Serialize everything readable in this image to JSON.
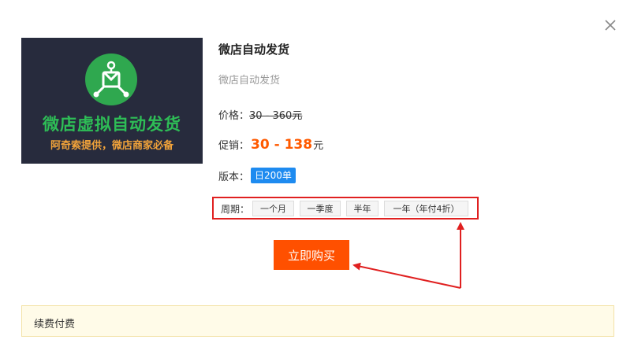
{
  "dialog": {
    "close_icon": "close-icon"
  },
  "banner": {
    "logo_icon": "shop-delivery-logo",
    "title": "微店虚拟自动发货",
    "subtitle": "阿奇索提供，微店商家必备",
    "colors": {
      "background": "#272b3d",
      "logo": "#2fa84f",
      "title": "#2ebd56",
      "subtitle": "#f2a33a"
    }
  },
  "product": {
    "title": "微店自动发货",
    "description": "微店自动发货",
    "price_label": "价格：",
    "price_value": "30 - 360元",
    "sale_label": "促销：",
    "sale_value": "30 - 138",
    "sale_unit": "元",
    "version_label": "版本：",
    "version_value": "日200单"
  },
  "period": {
    "label": "周期：",
    "options": [
      "一个月",
      "一季度",
      "半年",
      "一年（年付4折）"
    ]
  },
  "buy_button": {
    "label": "立即购买",
    "color": "#ff5000"
  },
  "notice": {
    "text": "续费付费"
  },
  "annotation": {
    "color": "#e02020"
  }
}
